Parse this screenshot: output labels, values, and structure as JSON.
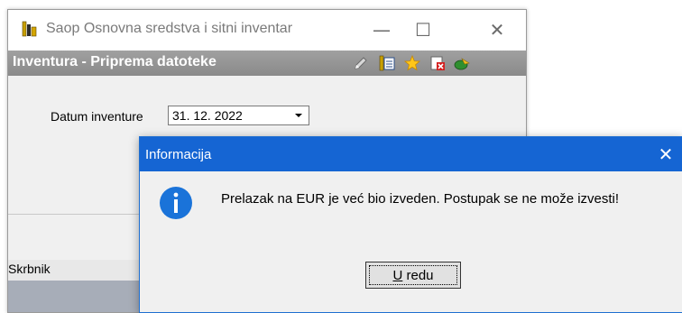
{
  "main_window": {
    "title": "Saop Osnovna sredstva i sitni inventar",
    "controls": {
      "minimize": "—",
      "maximize": "☐",
      "close": "✕"
    },
    "app_icon": "app-books-icon"
  },
  "form": {
    "title": "Inventura - Priprema datoteke",
    "toolbar_icons": [
      "edit-icon",
      "list-icon",
      "star-icon",
      "close-document-icon",
      "exit-icon"
    ],
    "datum_label": "Datum inventure",
    "datum_value": "31. 12. 2022"
  },
  "status": {
    "text": "Skrbnik"
  },
  "dialog": {
    "title": "Informacija",
    "close": "✕",
    "icon": "info-icon",
    "message": "Prelazak na EUR je već bio izveden. Postupak se ne može izvesti!",
    "ok_label_underlined": "U",
    "ok_label_rest": " redu"
  },
  "colors": {
    "dialog_titlebar": "#1565d3",
    "form_header": "#8f8f8f",
    "info_icon": "#1a73d9"
  }
}
